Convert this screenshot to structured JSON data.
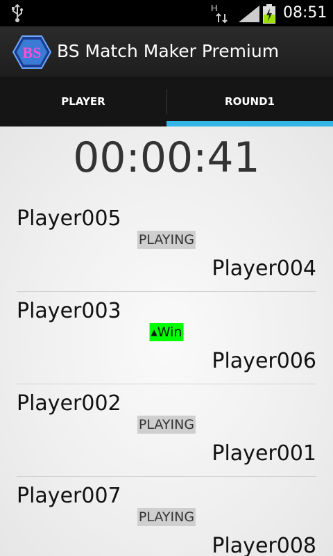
{
  "statusbar": {
    "time": "08:51",
    "network_label": "H"
  },
  "app": {
    "title": "BS Match Maker Premium",
    "logo_text": "BS"
  },
  "tabs": [
    {
      "label": "PLAYER",
      "selected": false
    },
    {
      "label": "ROUND1",
      "selected": true
    }
  ],
  "timer": "00:00:41",
  "matches": [
    {
      "player1": "Player005",
      "status": "PLAYING",
      "player2": "Player004"
    },
    {
      "player1": "Player003",
      "status": "Win",
      "status_icon": "triangle-up-icon",
      "player2": "Player006"
    },
    {
      "player1": "Player002",
      "status": "PLAYING",
      "player2": "Player001"
    },
    {
      "player1": "Player007",
      "status": "PLAYING",
      "player2": "Player008"
    }
  ],
  "colors": {
    "accent": "#33b5e5",
    "win": "#00ff00",
    "playing": "#cfcfcf",
    "battery_charge": "#9ee000"
  }
}
